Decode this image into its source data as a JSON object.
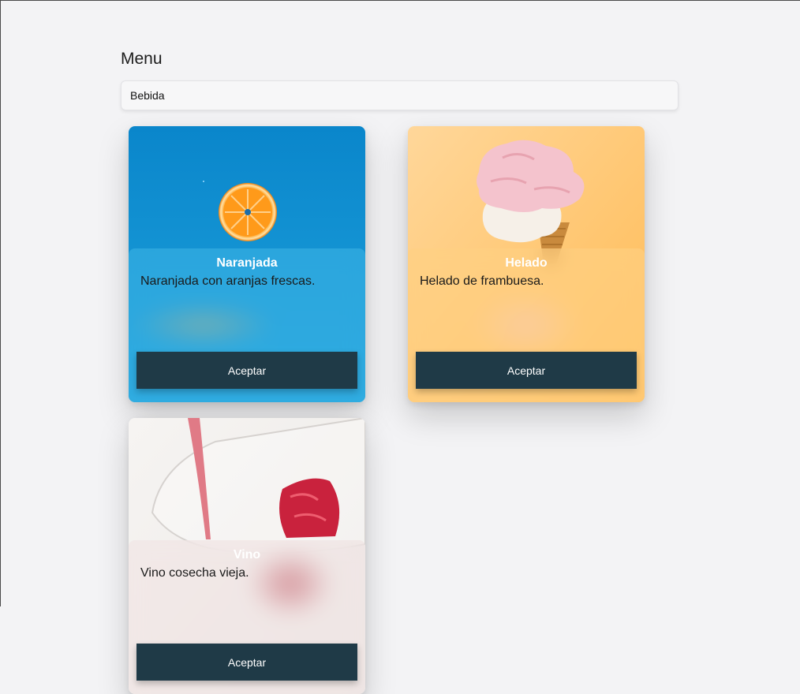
{
  "page": {
    "title": "Menu"
  },
  "search": {
    "value": "Bebida"
  },
  "cards": [
    {
      "name": "Naranjada",
      "description": "Naranjada con aranjas frescas.",
      "button": "Aceptar"
    },
    {
      "name": "Helado",
      "description": "Helado de frambuesa.",
      "button": "Aceptar"
    },
    {
      "name": "Vino",
      "description": "Vino cosecha vieja.",
      "button": "Aceptar"
    }
  ],
  "colors": {
    "background": "#f3f3f5",
    "button": "#1f3a47",
    "orange_card": "#0b8ccc",
    "icecream_card": "#ffc56e",
    "wine_card": "#f2f0ee"
  }
}
